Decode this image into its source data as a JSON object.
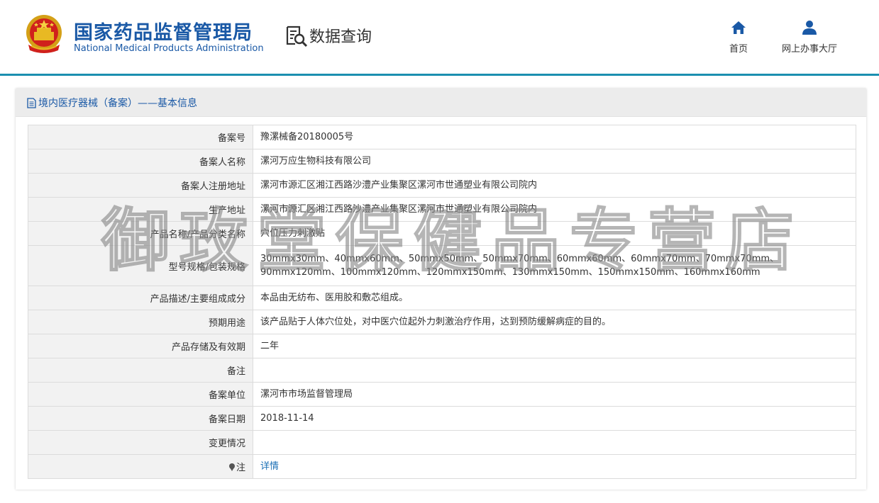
{
  "header": {
    "title_cn": "国家药品监督管理局",
    "title_en": "National Medical Products Administration",
    "data_query": "数据查询",
    "nav_home": "首页",
    "nav_hall": "网上办事大厅"
  },
  "panel": {
    "title": "境内医疗器械（备案）——基本信息"
  },
  "rows": [
    {
      "label": "备案号",
      "value": "豫漯械备20180005号"
    },
    {
      "label": "备案人名称",
      "value": "漯河万应生物科技有限公司"
    },
    {
      "label": "备案人注册地址",
      "value": "漯河市源汇区湘江西路沙澧产业集聚区漯河市世通塑业有限公司院内"
    },
    {
      "label": "生产地址",
      "value": "漯河市源汇区湘江西路沙澧产业集聚区漯河市世通塑业有限公司院内"
    },
    {
      "label": "产品名称/产品分类名称",
      "value": "穴位压力刺激贴"
    },
    {
      "label": "型号规格/包装规格",
      "value": "30mmx30mm、40mmx60mm、50mmx50mm、50mmx70mm、60mmx60mm、60mmx70mm、70mmx70mm、90mmx120mm、100mmx120mm、120mmx150mm、130mmx150mm、150mmx150mm、160mmx160mm"
    },
    {
      "label": "产品描述/主要组成成分",
      "value": "本品由无纺布、医用胶和敷芯组成。"
    },
    {
      "label": "预期用途",
      "value": "该产品贴于人体穴位处，对中医穴位起外力刺激治疗作用，达到预防缓解病症的目的。"
    },
    {
      "label": "产品存储及有效期",
      "value": "二年"
    },
    {
      "label": "备注",
      "value": ""
    },
    {
      "label": "备案单位",
      "value": "漯河市市场监督管理局"
    },
    {
      "label": "备案日期",
      "value": "2018-11-14"
    },
    {
      "label": "变更情况",
      "value": ""
    },
    {
      "label": "注",
      "value": "详情"
    }
  ],
  "watermark": "御玫堂保健品专营店",
  "colors": {
    "brand_blue": "#1a59a6",
    "header_line": "#1b8fb0",
    "label_bg": "#f2f2f2",
    "link": "#1a6fb5"
  },
  "icons": {
    "emblem": "national-emblem-icon",
    "data_query": "document-search-icon",
    "home": "home-icon",
    "hall": "user-icon",
    "title": "document-icon",
    "note": "pin-icon"
  }
}
